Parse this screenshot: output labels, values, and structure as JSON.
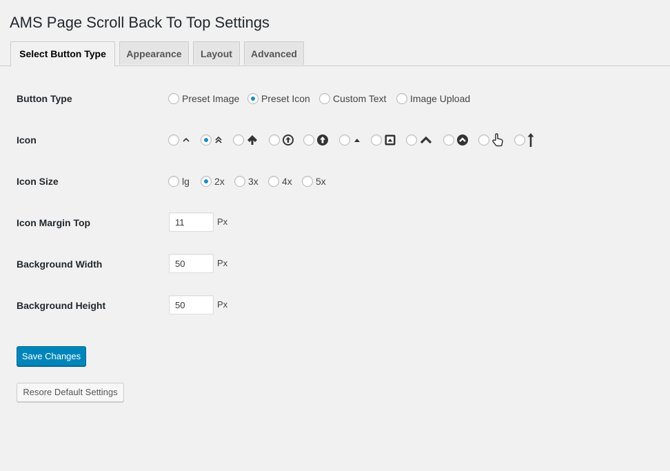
{
  "page": {
    "title": "AMS Page Scroll Back To Top Settings"
  },
  "tabs": [
    {
      "label": "Select Button Type",
      "active": true
    },
    {
      "label": "Appearance",
      "active": false
    },
    {
      "label": "Layout",
      "active": false
    },
    {
      "label": "Advanced",
      "active": false
    }
  ],
  "button_type": {
    "label": "Button Type",
    "options": [
      "Preset Image",
      "Preset Icon",
      "Custom Text",
      "Image Upload"
    ],
    "selected": "Preset Icon"
  },
  "icon": {
    "label": "Icon",
    "options": [
      "angle-up-icon",
      "angle-double-up-icon",
      "arrow-up-icon",
      "arrow-circle-o-up-icon",
      "arrow-circle-up-icon",
      "caret-up-icon",
      "caret-square-o-up-icon",
      "chevron-up-icon",
      "chevron-circle-up-icon",
      "hand-o-up-icon",
      "long-arrow-up-icon"
    ],
    "selected_index": 1
  },
  "icon_size": {
    "label": "Icon Size",
    "options": [
      "lg",
      "2x",
      "3x",
      "4x",
      "5x"
    ],
    "selected": "2x"
  },
  "icon_margin_top": {
    "label": "Icon Margin Top",
    "value": "11",
    "unit": "Px"
  },
  "background_width": {
    "label": "Background Width",
    "value": "50",
    "unit": "Px"
  },
  "background_height": {
    "label": "Background Height",
    "value": "50",
    "unit": "Px"
  },
  "buttons": {
    "save": "Save Changes",
    "restore": "Resore Default Settings"
  },
  "colors": {
    "primary": "#0085ba",
    "radio_dot": "#1e8cbe",
    "background": "#f1f1f1"
  }
}
